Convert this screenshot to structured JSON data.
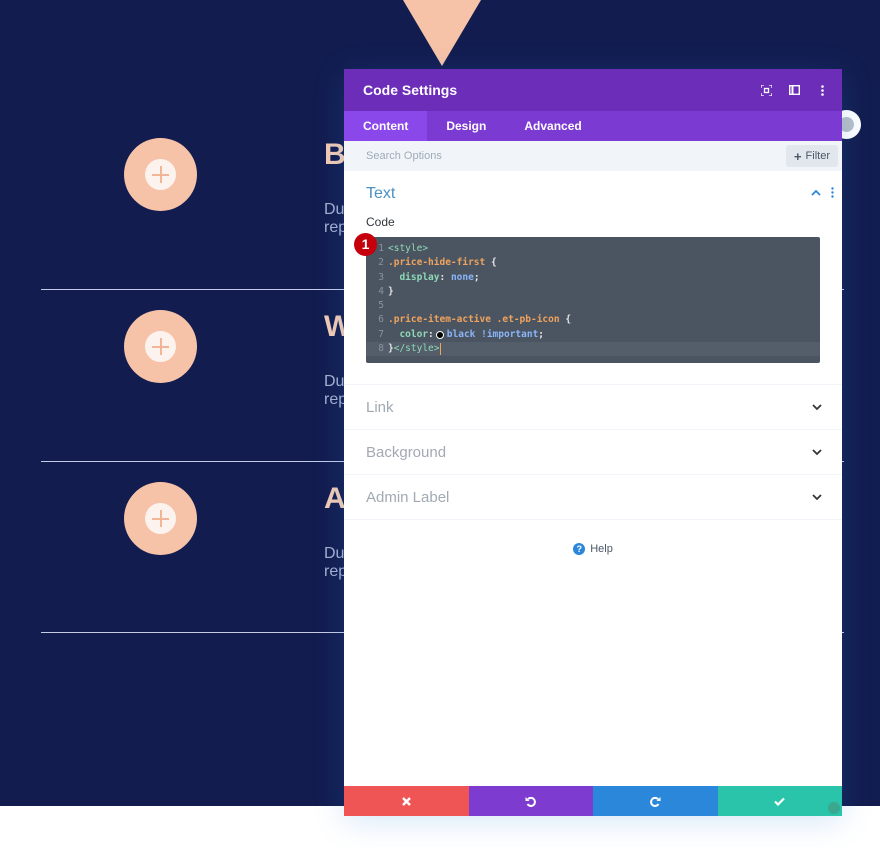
{
  "background": {
    "rows": [
      {
        "title": "B",
        "desc_line1": "Du",
        "desc_line2": "rep"
      },
      {
        "title": "W",
        "desc_line1": "Du",
        "desc_line2": "rep"
      },
      {
        "title": "A",
        "desc_line1": "Du",
        "desc_line2": "rep"
      }
    ]
  },
  "modal": {
    "title": "Code Settings",
    "header_icons": [
      "focus-icon",
      "split-view-icon",
      "more-vertical-icon"
    ],
    "tabs": [
      {
        "label": "Content",
        "active": true
      },
      {
        "label": "Design",
        "active": false
      },
      {
        "label": "Advanced",
        "active": false
      }
    ],
    "search": {
      "placeholder": "Search Options",
      "value": ""
    },
    "filter_label": "Filter",
    "open_section": {
      "title": "Text",
      "field_label": "Code",
      "badge": "1",
      "code_lines": [
        {
          "n": "1",
          "text": "<style>"
        },
        {
          "n": "2",
          "text": ".price-hide-first {"
        },
        {
          "n": "3",
          "text": "  display: none;"
        },
        {
          "n": "4",
          "text": "}"
        },
        {
          "n": "5",
          "text": ""
        },
        {
          "n": "6",
          "text": ".price-item-active .et-pb-icon {"
        },
        {
          "n": "7",
          "text": "  color: black !important;"
        },
        {
          "n": "8",
          "text": "}</style>"
        }
      ]
    },
    "closed_sections": [
      {
        "title": "Link"
      },
      {
        "title": "Background"
      },
      {
        "title": "Admin Label"
      }
    ],
    "help_label": "Help",
    "footer": {
      "cancel": "close-icon",
      "undo": "undo-icon",
      "redo": "redo-icon",
      "save": "check-icon"
    },
    "colors": {
      "header": "#6c2eb9",
      "tabs": "#7b3ad2",
      "active_tab": "#8a47ea",
      "cancel": "#ef5555",
      "undo": "#7e3bd0",
      "redo": "#2b87da",
      "save": "#29c4a9"
    }
  }
}
